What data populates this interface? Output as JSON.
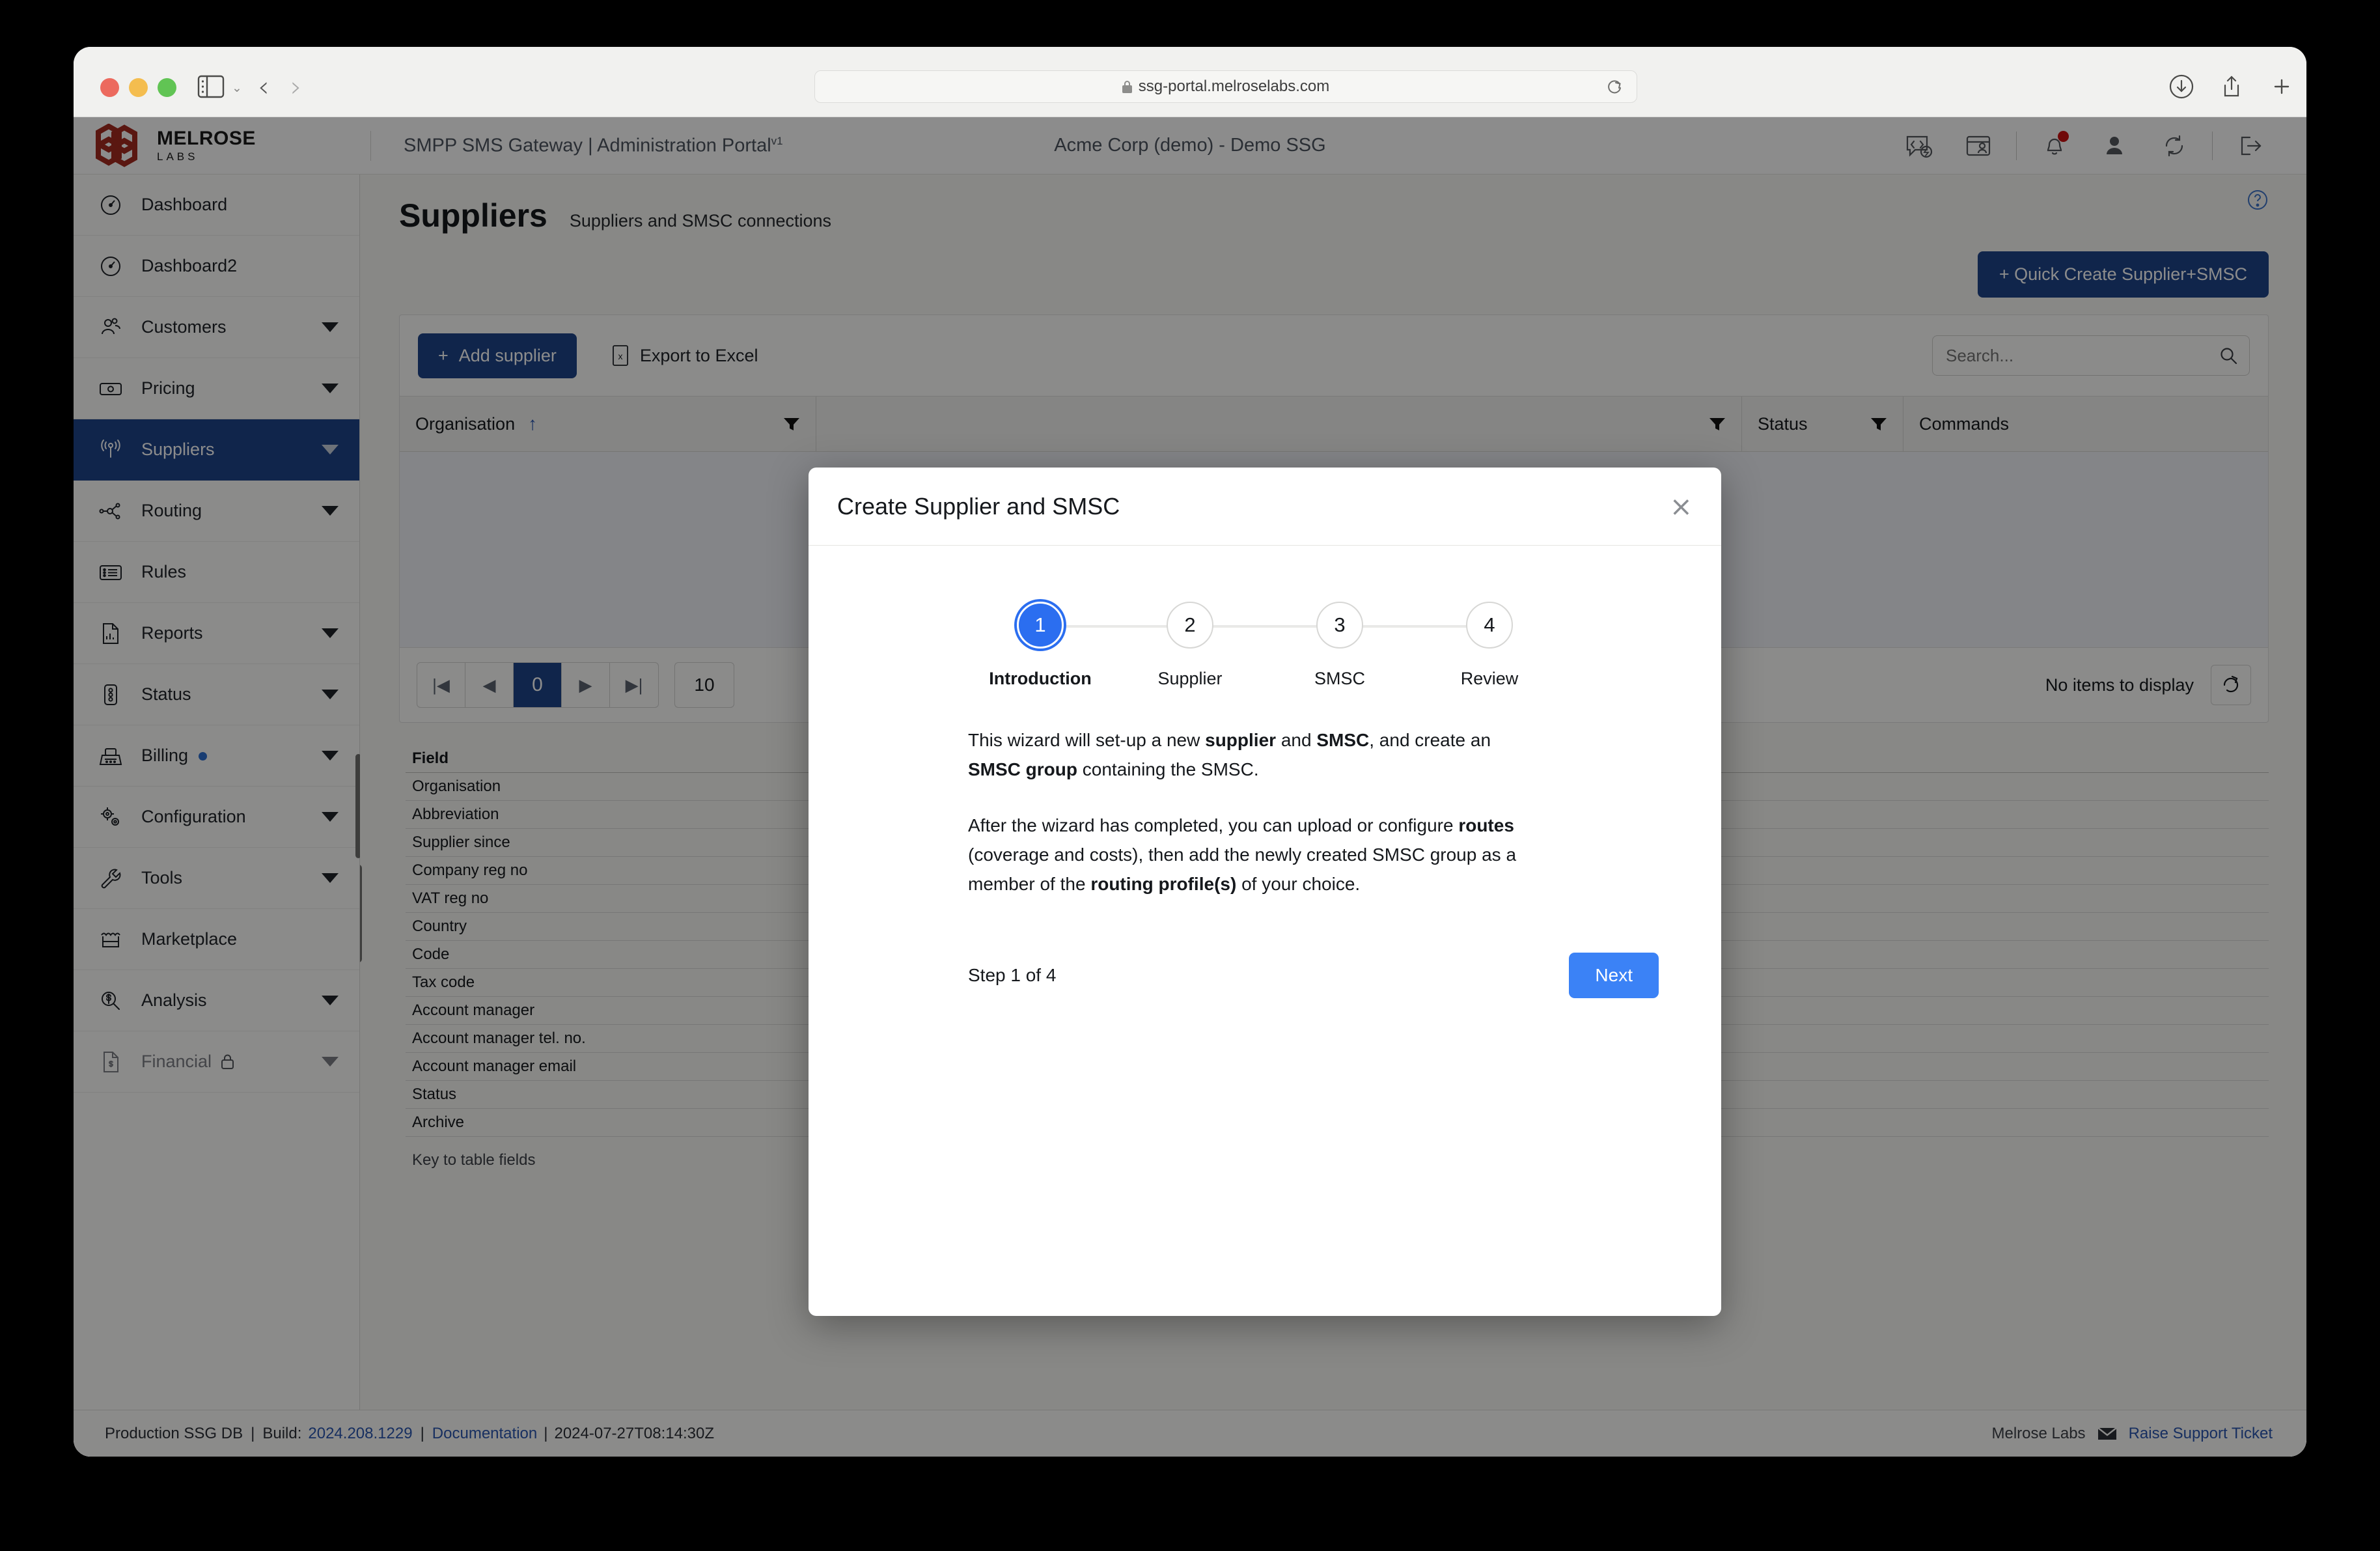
{
  "browser": {
    "url": "ssg-portal.melroselabs.com",
    "traffic_lights": [
      "close",
      "minimize",
      "maximize"
    ],
    "icons": {
      "sidebar_toggle": "sidebar-toggle-icon",
      "back": "back-chevron-icon",
      "forward": "forward-chevron-icon",
      "lock": "lock-icon",
      "reload": "reload-icon",
      "download": "download-icon",
      "share": "share-icon",
      "new_tab": "plus-icon",
      "tab_overview": "tabs-icon"
    }
  },
  "header": {
    "brand_name": "MELROSE",
    "brand_sub": "LABS",
    "app_title": "SMPP SMS Gateway | Administration Portal",
    "app_version": "v1",
    "tenant": "Acme Corp (demo) - Demo SSG",
    "icons": [
      {
        "name": "api-console-icon"
      },
      {
        "name": "portal-window-icon"
      },
      {
        "name": "notifications-bell-icon",
        "badge": true
      },
      {
        "name": "user-account-icon"
      },
      {
        "name": "refresh-session-icon"
      },
      {
        "name": "logout-icon"
      }
    ]
  },
  "sidebar": {
    "items": [
      {
        "label": "Dashboard",
        "icon": "gauge-icon",
        "caret": false,
        "active": false,
        "dot": false,
        "lock": false
      },
      {
        "label": "Dashboard2",
        "icon": "gauge-icon",
        "caret": false,
        "active": false,
        "dot": false,
        "lock": false
      },
      {
        "label": "Customers",
        "icon": "users-icon",
        "caret": true,
        "active": false,
        "dot": false,
        "lock": false
      },
      {
        "label": "Pricing",
        "icon": "banknote-icon",
        "caret": true,
        "active": false,
        "dot": false,
        "lock": false
      },
      {
        "label": "Suppliers",
        "icon": "antenna-icon",
        "caret": true,
        "active": true,
        "dot": false,
        "lock": false
      },
      {
        "label": "Routing",
        "icon": "network-icon",
        "caret": true,
        "active": false,
        "dot": false,
        "lock": false
      },
      {
        "label": "Rules",
        "icon": "list-icon",
        "caret": false,
        "active": false,
        "dot": false,
        "lock": false
      },
      {
        "label": "Reports",
        "icon": "report-icon",
        "caret": true,
        "active": false,
        "dot": false,
        "lock": false
      },
      {
        "label": "Status",
        "icon": "traffic-light-icon",
        "caret": true,
        "active": false,
        "dot": false,
        "lock": false
      },
      {
        "label": "Billing",
        "icon": "register-icon",
        "caret": true,
        "active": false,
        "dot": true,
        "lock": false
      },
      {
        "label": "Configuration",
        "icon": "gears-icon",
        "caret": true,
        "active": false,
        "dot": false,
        "lock": false
      },
      {
        "label": "Tools",
        "icon": "wrench-icon",
        "caret": true,
        "active": false,
        "dot": false,
        "lock": false
      },
      {
        "label": "Marketplace",
        "icon": "storefront-icon",
        "caret": false,
        "active": false,
        "dot": false,
        "lock": false
      },
      {
        "label": "Analysis",
        "icon": "search-dollar-icon",
        "caret": true,
        "active": false,
        "dot": false,
        "lock": false
      },
      {
        "label": "Financial",
        "icon": "invoice-icon",
        "caret": true,
        "active": false,
        "dot": false,
        "lock": true
      }
    ]
  },
  "page": {
    "title": "Suppliers",
    "subtitle": "Suppliers and SMSC connections",
    "help_icon": "help-circle-icon",
    "quick_create_label": "+ Quick Create Supplier+SMSC"
  },
  "toolbar": {
    "add_supplier_label": "Add supplier",
    "add_supplier_plus": "+",
    "export_label": "Export to Excel",
    "export_icon": "excel-file-icon",
    "search_placeholder": "Search...",
    "search_value": "",
    "search_icon": "search-icon"
  },
  "grid": {
    "columns": [
      {
        "label": "Organisation",
        "sort": "asc",
        "filter": true
      },
      {
        "label": "",
        "sort": "",
        "filter": true
      },
      {
        "label": "Status",
        "sort": "",
        "filter": true
      },
      {
        "label": "Commands",
        "sort": "",
        "filter": false
      }
    ],
    "rows": [],
    "empty_text": "No items to display",
    "refresh_icon": "refresh-icon",
    "pager": {
      "first": "|◀",
      "prev": "◀",
      "current_page": "0",
      "next": "▶",
      "last": "▶|",
      "page_size": "10"
    }
  },
  "key_table": {
    "header": "Field",
    "caption": "Key to table fields",
    "fields": [
      "Organisation",
      "Abbreviation",
      "Supplier since",
      "Company reg no",
      "VAT reg no",
      "Country",
      "Code",
      "Tax code",
      "Account manager",
      "Account manager tel. no.",
      "Account manager email",
      "Status",
      "Archive"
    ]
  },
  "footer": {
    "db": "Production SSG DB",
    "sep1": "|",
    "build_label": "Build:",
    "build_version": "2024.208.1229",
    "sep2": "|",
    "documentation": "Documentation",
    "sep3": "|",
    "timestamp": "2024-07-27T08:14:30Z",
    "company": "Melrose Labs",
    "support_icon": "mail-icon",
    "support_link": "Raise Support Ticket"
  },
  "modal": {
    "title": "Create Supplier and SMSC",
    "close_icon": "close-icon",
    "steps": [
      {
        "number": "1",
        "label": "Introduction",
        "active": true
      },
      {
        "number": "2",
        "label": "Supplier",
        "active": false
      },
      {
        "number": "3",
        "label": "SMSC",
        "active": false
      },
      {
        "number": "4",
        "label": "Review",
        "active": false
      }
    ],
    "paragraph1": {
      "a": "This wizard will set-up a new ",
      "b1": "supplier",
      "c": " and ",
      "b2": "SMSC",
      "d": ", and create an ",
      "b3": "SMSC group",
      "e": " containing the SMSC."
    },
    "paragraph2": {
      "a": "After the wizard has completed, you can upload or configure ",
      "b1": "routes",
      "c": " (coverage and costs), then add the newly created SMSC group as a member of the ",
      "b2": "routing profile(s)",
      "d": " of your choice."
    },
    "step_indicator": "Step 1 of 4",
    "next_label": "Next"
  },
  "colors": {
    "brand_red": "#a52a1f",
    "nav_active": "#1e4489",
    "primary_button": "#1e4489",
    "next_button": "#3b82f6",
    "step_active": "#2b6ef0",
    "link": "#2a56b0",
    "badge_red": "#cc1111"
  }
}
